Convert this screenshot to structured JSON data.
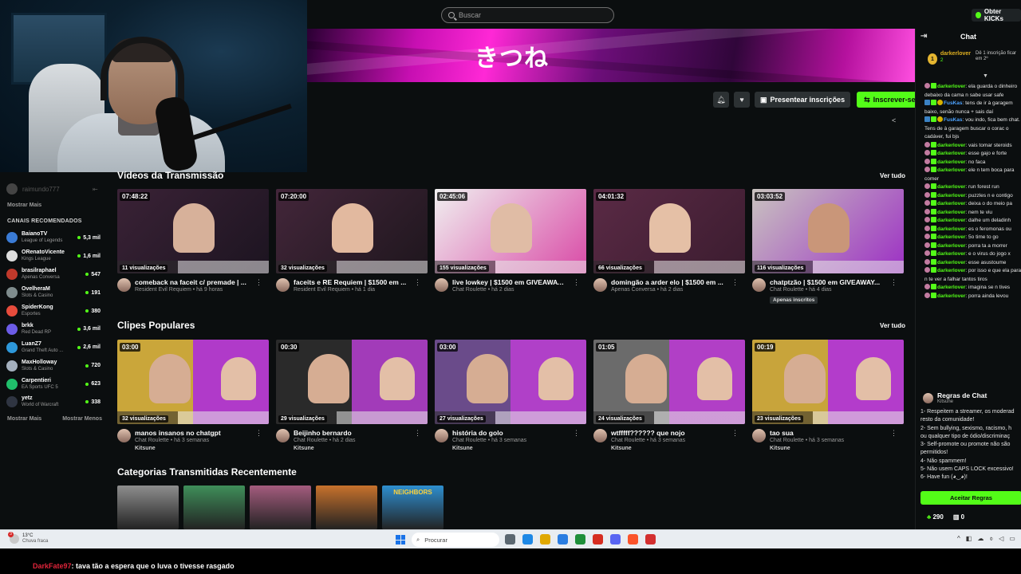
{
  "topbar": {
    "search_placeholder": "Buscar",
    "get_kicks_label": "Obter KICKs"
  },
  "banner": {
    "title": "きつね"
  },
  "channel_actions": {
    "gift_label": "Presentear inscrições",
    "follow_label": "Inscrever-se"
  },
  "sidebar": {
    "followed_user": "raimundo777",
    "show_more_top": "Mostrar Mais",
    "recommended_title": "CANAIS RECOMENDADOS",
    "recommended": [
      {
        "name": "BaianoTV",
        "game": "League of Legends",
        "viewers": "5,3 mil",
        "color": "#3a7bd5"
      },
      {
        "name": "ORenatoVicente",
        "game": "Kings League",
        "viewers": "1,6 mil",
        "color": "#dddddd"
      },
      {
        "name": "brasilraphael",
        "game": "Apenas Conversa",
        "viewers": "547",
        "color": "#c0392b"
      },
      {
        "name": "OvelheraM",
        "game": "Slots & Casino",
        "viewers": "191",
        "color": "#7f8c8d"
      },
      {
        "name": "SpiderKong",
        "game": "Esportes",
        "viewers": "380",
        "color": "#e74c3c"
      },
      {
        "name": "brkk",
        "game": "Red Dead RP",
        "viewers": "3,6 mil",
        "color": "#6c5ce7"
      },
      {
        "name": "LuanZ7",
        "game": "Grand Theft Auto ...",
        "viewers": "2,6 mil",
        "color": "#2d98da"
      },
      {
        "name": "MaxHolloway",
        "game": "Slots & Casino",
        "viewers": "720",
        "color": "#a4b0be"
      },
      {
        "name": "Carpentieri",
        "game": "EA Sports UFC 5",
        "viewers": "623",
        "color": "#20bf6b"
      },
      {
        "name": "yetz",
        "game": "World of Warcraft",
        "viewers": "338",
        "color": "#2f3542"
      }
    ],
    "show_more_bottom": "Mostrar Mais",
    "show_less": "Mostrar Menos"
  },
  "videos": {
    "title": "Vídeos da Transmissão",
    "see_all": "Ver tudo",
    "items": [
      {
        "duration": "07:48:22",
        "views": "11 visualizações",
        "title": "comeback na faceit c/ premade | ...",
        "sub": "Resident Evil Requiem • há 9 horas",
        "bg1": "#3a2236",
        "bg2": "#1c1420",
        "p": "#d7b19a"
      },
      {
        "duration": "07:20:00",
        "views": "32 visualizações",
        "title": "faceits e RE Requiem | $1500 em ...",
        "sub": "Resident Evil Requiem • há 1 dia",
        "bg1": "#43263a",
        "bg2": "#1e161d",
        "p": "#e2b99f"
      },
      {
        "duration": "02:45:06",
        "views": "155 visualizações",
        "title": "live lowkey | $1500 em GIVEAWAY...",
        "sub": "Chat Roulette • há 2 dias",
        "bg1": "#f0f0f0",
        "bg2": "#d94aa6",
        "p": "#e0bca5"
      },
      {
        "duration": "04:01:32",
        "views": "66 visualizações",
        "title": "domingão a arder elo | $1500 em ...",
        "sub": "Apenas Conversa • há 2 dias",
        "bg1": "#5a2a45",
        "bg2": "#3b1c2f",
        "p": "#e5c0a6"
      },
      {
        "duration": "03:03:52",
        "views": "116 visualizações",
        "title": "chatptzão | $1500 em GIVEAWAY...",
        "sub": "Chat Roulette • há 4 dias",
        "badge": "Apenas inscritos",
        "bg1": "#c9c4bf",
        "bg2": "#9c2fc4",
        "p": "#c99679"
      }
    ]
  },
  "clips": {
    "title": "Clipes Populares",
    "see_all": "Ver tudo",
    "items": [
      {
        "duration": "03:00",
        "views": "32 visualizações",
        "title": "manos insanos no chatgpt",
        "sub": "Chat Roulette • há 3 semanas",
        "owner": "Kitsune",
        "bg1": "#caa63a",
        "bg2": "#b03ac9"
      },
      {
        "duration": "00:30",
        "views": "29 visualizações",
        "title": "Beijinho bernardo",
        "sub": "Chat Roulette • há 2 dias",
        "owner": "Kitsune",
        "bg1": "#2a2a2a",
        "bg2": "#a23bb9"
      },
      {
        "duration": "03:00",
        "views": "27 visualizações",
        "title": "história do golo",
        "sub": "Chat Roulette • há 3 semanas",
        "owner": "Kitsune",
        "bg1": "#6a4b8a",
        "bg2": "#b040c8"
      },
      {
        "duration": "01:05",
        "views": "24 visualizações",
        "title": "wtfffff?????? que nojo",
        "sub": "Chat Roulette • há 3 semanas",
        "owner": "Kitsune",
        "bg1": "#6b6b6b",
        "bg2": "#b13fc6"
      },
      {
        "duration": "00:19",
        "views": "23 visualizações",
        "title": "tao sua",
        "sub": "Chat Roulette • há 3 semanas",
        "owner": "Kitsune",
        "bg1": "#c8a43b",
        "bg2": "#b33ccb"
      }
    ]
  },
  "categories": {
    "title": "Categorias Transmitidas Recentemente",
    "items": [
      {
        "color": "#8e8e8e"
      },
      {
        "color": "#3f8f5a"
      },
      {
        "color": "#a45c7e"
      },
      {
        "color": "#c7722c"
      },
      {
        "color": "#2e8fcf",
        "label": "NEIGHBORS"
      }
    ]
  },
  "chat": {
    "title": "Chat",
    "pinned": {
      "rank": "1",
      "user": "darkerlover",
      "amount": "2",
      "note": "Dê 1 inscrição ficar em 2º"
    },
    "messages": [
      {
        "icon": "cat",
        "user": "darkerlover",
        "text": ": ela guarda o dinheiro debaixo da cama n sabe usar safe"
      },
      {
        "icon": "badges",
        "user": "FusKas",
        "text": ": tens de ir à garagem baixo, senão nunca + sais daí",
        "blue": true
      },
      {
        "icon": "badges",
        "user": "FusKas",
        "text": ": vou indo, fica bem chat. Tens de à garagem buscar o corac o cadáver, fui bjs",
        "blue": true
      },
      {
        "icon": "cat",
        "user": "darkerlover",
        "text": ": vais tomar steroids"
      },
      {
        "icon": "cat",
        "user": "darkerlover",
        "text": ": esse gajo e forte"
      },
      {
        "icon": "cat",
        "user": "darkerlover",
        "text": ": no faca"
      },
      {
        "icon": "cat",
        "user": "darkerlover",
        "text": ": ele n tem boca para comer"
      },
      {
        "icon": "cat",
        "user": "darkerlover",
        "text": ": run forest run"
      },
      {
        "icon": "cat",
        "user": "darkerlover",
        "text": ": puzzles n e contigo"
      },
      {
        "icon": "cat",
        "user": "darkerlover",
        "text": ": deixa o do meio pa"
      },
      {
        "icon": "cat",
        "user": "darkerlover",
        "text": ": nem te viu"
      },
      {
        "icon": "cat",
        "user": "darkerlover",
        "text": ": dalhe um deladinh"
      },
      {
        "icon": "cat",
        "user": "darkerlover",
        "text": ": es o feromonas ou"
      },
      {
        "icon": "cat",
        "user": "darkerlover",
        "text": ": 5o time to go"
      },
      {
        "icon": "cat",
        "user": "darkerlover",
        "text": ": porra ta a morrer"
      },
      {
        "icon": "cat",
        "user": "darkerlover",
        "text": ": e o virus do jogo x"
      },
      {
        "icon": "cat",
        "user": "darkerlover",
        "text": ": esse asustoume"
      },
      {
        "icon": "cat",
        "user": "darkerlover",
        "text": ": por isso e que ela para n te ver a falhar tantos tiros"
      },
      {
        "icon": "cat",
        "user": "darkerlover",
        "text": ": imagina se n tives"
      },
      {
        "icon": "cat",
        "user": "darkerlover",
        "text": ": porra ainda levou"
      }
    ],
    "rules": {
      "title": "Regras de Chat",
      "owner": "Kitsune",
      "lines": [
        "1- Respeitem a streamer, os moderad",
        "resto da comunidade!",
        "2- Sem bullying, sexismo, racismo, h",
        "ou qualquer tipo de ódio/discriminaç",
        "3- Self-promote ou promote não são",
        "permitidos!",
        "4- Não spammem!",
        "5- Não usem CAPS LOCK excessivo!",
        "6- Have fun (◕‿◕)!"
      ],
      "accept_label": "Aceitar Regras"
    },
    "footer": {
      "kicks": "290",
      "subs": "0"
    }
  },
  "taskbar": {
    "temp": "13°C",
    "condition": "Chuva fraca",
    "weather_badge": "3",
    "search_label": "Procurar",
    "app_colors": [
      "#5b6770",
      "#1e88e5",
      "#e0a800",
      "#2a7de1",
      "#1f8f3a",
      "#d62d20",
      "#5865f2",
      "#fb542b",
      "#d32f2f"
    ]
  },
  "caption": {
    "user": "DarkFate97",
    "text": ": tava tão a espera que o luva o tivesse rasgado"
  }
}
